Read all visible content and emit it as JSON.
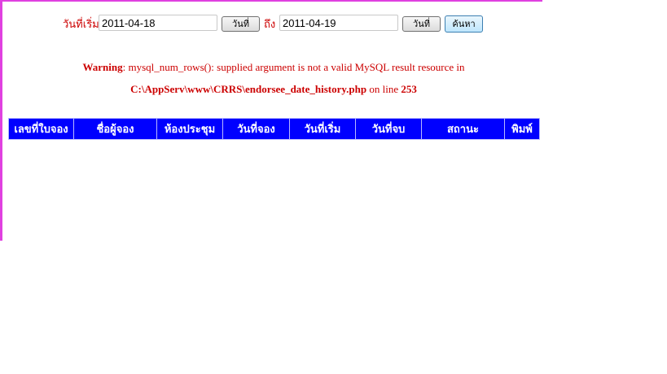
{
  "search": {
    "start_label": "วันที่เริ่ม",
    "start_value": "2011-04-18",
    "start_picker_label": "วันที่",
    "to_label": "ถึง",
    "end_value": "2011-04-19",
    "end_picker_label": "วันที่",
    "search_button_label": "ค้นหา"
  },
  "warning": {
    "prefix": "Warning",
    "message": ": mysql_num_rows(): supplied argument is not a valid MySQL result resource in",
    "file_path": "C:\\AppServ\\www\\CRRS\\endorsee_date_history.php",
    "on_line_text": " on line ",
    "line_number": "253"
  },
  "table": {
    "headers": [
      "เลขที่ใบจอง",
      "ชื่อผู้จอง",
      "ห้องประชุม",
      "วันที่จอง",
      "วันที่เริ่ม",
      "วันที่จบ",
      "สถานะ",
      "พิมพ์"
    ],
    "header_bg_color": "#0000ff"
  },
  "colors": {
    "frame": "#e040e0",
    "label_red": "#cc0000"
  }
}
